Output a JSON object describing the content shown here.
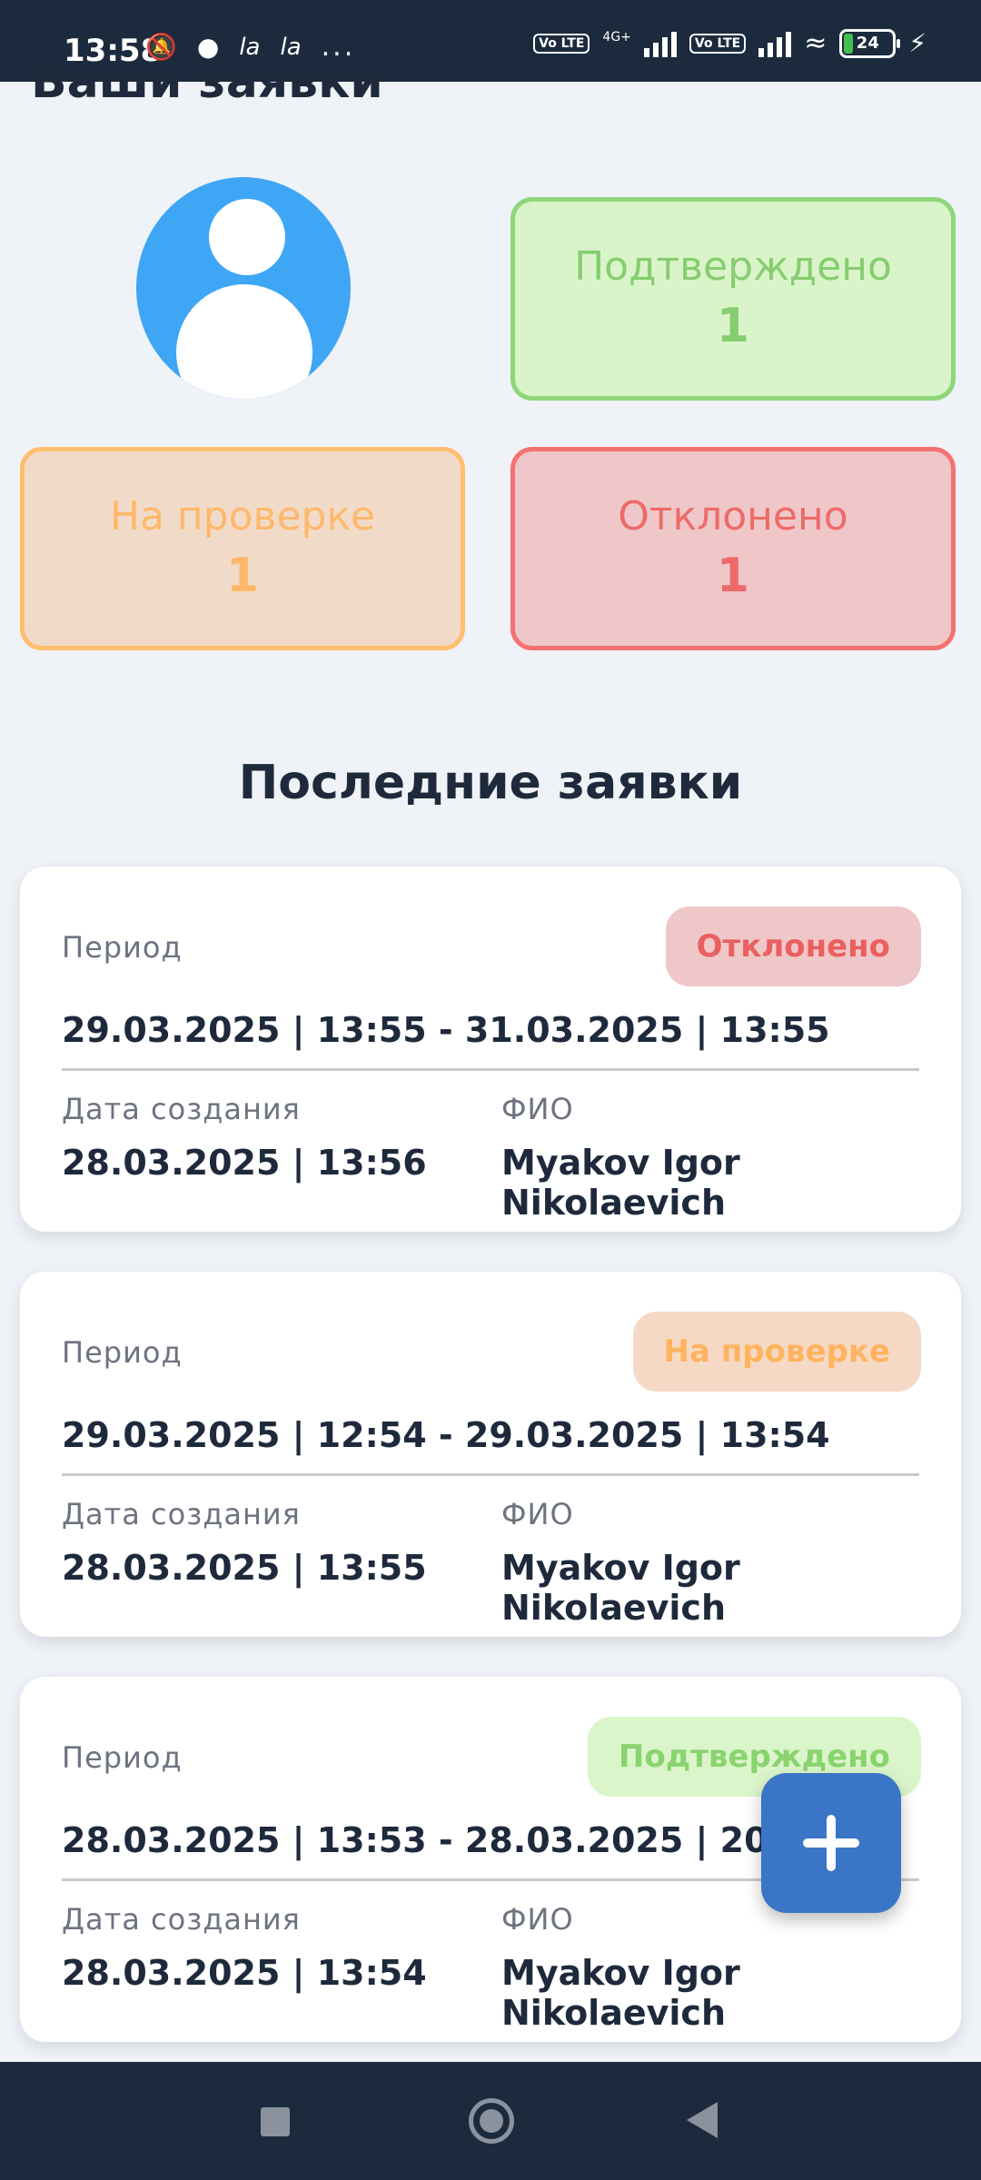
{
  "status_bar": {
    "time": "13:58",
    "icons_left": [
      "bell-off-icon",
      "app-icon",
      "la",
      "la",
      "..."
    ],
    "volte1": "Vo LTE",
    "network": "4G+",
    "volte2": "Vo LTE",
    "battery": "24"
  },
  "page": {
    "title": "Ваши заявки",
    "section_title": "Последние заявки"
  },
  "stats": {
    "confirmed": {
      "label": "Подтверждено",
      "count": "1",
      "color": "#86cd70"
    },
    "pending": {
      "label": "На проверке",
      "count": "1",
      "color": "#ffb86a"
    },
    "rejected": {
      "label": "Отклонено",
      "count": "1",
      "color": "#ee6a6a"
    }
  },
  "cards": [
    {
      "period_label": "Период",
      "status": "Отклонено",
      "period": "29.03.2025 | 13:55 - 31.03.2025 | 13:55",
      "created_label": "Дата создания",
      "created": "28.03.2025 | 13:56",
      "fio_label": "ФИО",
      "fio": "Myakov Igor Nikolaevich"
    },
    {
      "period_label": "Период",
      "status": "На проверке",
      "period": "29.03.2025 | 12:54 - 29.03.2025 | 13:54",
      "created_label": "Дата создания",
      "created": "28.03.2025 | 13:55",
      "fio_label": "ФИО",
      "fio": "Myakov Igor Nikolaevich"
    },
    {
      "period_label": "Период",
      "status": "Подтверждено",
      "period": "28.03.2025 | 13:53 - 28.03.2025 | 20:53",
      "created_label": "Дата создания",
      "created": "28.03.2025 | 13:54",
      "fio_label": "ФИО",
      "fio": "Myakov Igor Nikolaevich"
    }
  ],
  "fab": {
    "icon": "plus-icon"
  },
  "nav": {
    "icons": [
      "recents-icon",
      "home-icon",
      "back-icon"
    ]
  }
}
